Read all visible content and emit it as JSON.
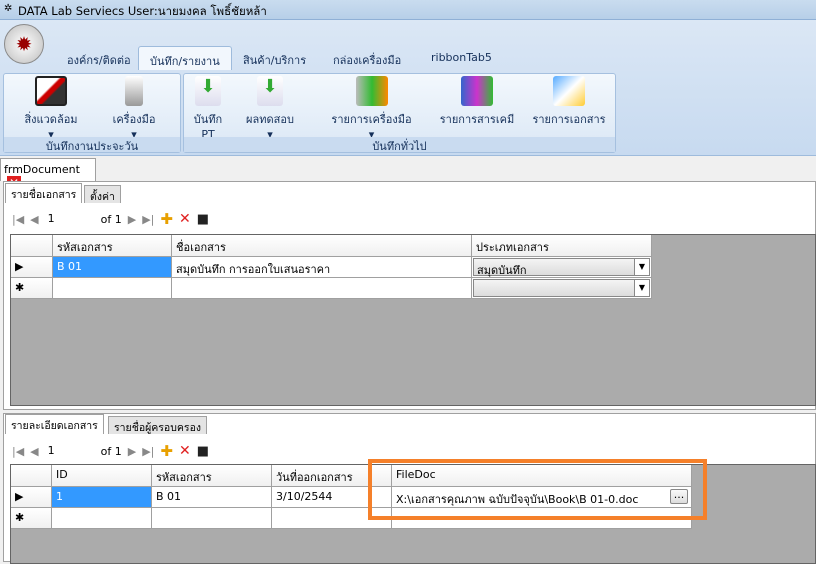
{
  "window": {
    "title": "DATA Lab Serviecs User:นายมงคล โพธิ์ชัยหล้า"
  },
  "ribbon": {
    "tabs": [
      {
        "label": "องค์กร/ติดต่อ"
      },
      {
        "label": "บันทึก/รายงาน"
      },
      {
        "label": "สินค้า/บริการ"
      },
      {
        "label": "กล่องเครื่องมือ"
      },
      {
        "label": "ribbonTab5"
      }
    ],
    "groups": [
      {
        "label": "บันทึกงานประจะวัน",
        "buttons": [
          {
            "label": "สิ่งแวดล้อม"
          },
          {
            "label": "เครื่องมือ"
          }
        ]
      },
      {
        "label": "บันทึกทั่วไป",
        "buttons": [
          {
            "label": "บันทึก PT"
          },
          {
            "label": "ผลทดสอบ"
          },
          {
            "label": "รายการเครื่องมือ"
          },
          {
            "label": "รายการสารเคมี"
          },
          {
            "label": "รายการเอกสาร"
          }
        ]
      }
    ]
  },
  "doc_tab": {
    "label": "frmDocument",
    "close": "✕"
  },
  "upper": {
    "tabs": [
      {
        "label": "รายชื่อเอกสาร"
      },
      {
        "label": "ตั้งค่า"
      }
    ],
    "nav": {
      "position": "1",
      "of": "of 1"
    },
    "columns": [
      "รหัสเอกสาร",
      "ชื่อเอกสาร",
      "ประเภทเอกสาร"
    ],
    "rows": [
      {
        "code": "B 01",
        "name": "สมุดบันทึก การออกใบเสนอราคา",
        "type": "สมุดบันทึก"
      }
    ]
  },
  "lower": {
    "tabs": [
      {
        "label": "รายละเอียดเอกสาร"
      },
      {
        "label": "รายชื่อผู้ครอบครอง"
      }
    ],
    "nav": {
      "position": "1",
      "of": "of 1"
    },
    "columns": [
      "ID",
      "รหัสเอกสาร",
      "วันที่ออกเอกสาร",
      "FileDoc"
    ],
    "rows": [
      {
        "id": "1",
        "code": "B 01",
        "date": "3/10/2544",
        "file": "X:\\เอกสารคุณภาพ ฉบับปัจจุบัน\\Book\\B 01-0.doc",
        "browse": "..."
      }
    ]
  },
  "highlight_color": "#f5802a"
}
